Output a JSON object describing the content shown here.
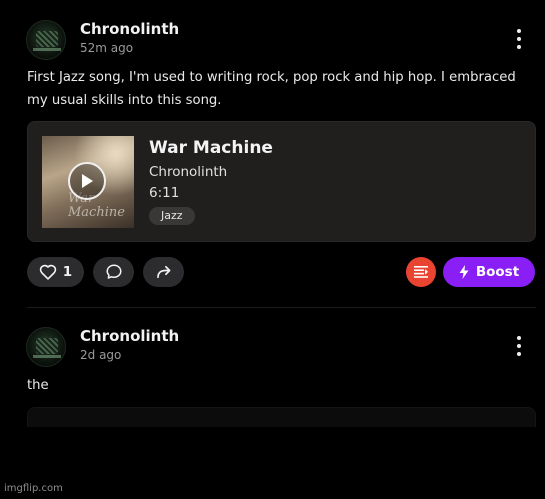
{
  "posts": [
    {
      "username": "Chronolinth",
      "time": "52m ago",
      "text": "First Jazz song, I'm used to writing rock, pop rock and hip hop. I embraced my usual skills into this song.",
      "track": {
        "title": "War Machine",
        "artist": "Chronolinth",
        "duration": "6:11",
        "genre": "Jazz",
        "cover_text": "War Machine"
      },
      "actions": {
        "like_count": "1",
        "boost_label": "Boost"
      }
    },
    {
      "username": "Chronolinth",
      "time": "2d ago",
      "text": "the"
    }
  ],
  "watermark": "imgflip.com",
  "colors": {
    "background": "#000000",
    "card": "#211f1e",
    "pill": "#2c2c2e",
    "queue_button": "#e84431",
    "boost_button": "#8a1ff5"
  },
  "icons": [
    "more-vertical-icon",
    "play-icon",
    "heart-icon",
    "comment-icon",
    "share-icon",
    "queue-icon",
    "bolt-icon"
  ]
}
